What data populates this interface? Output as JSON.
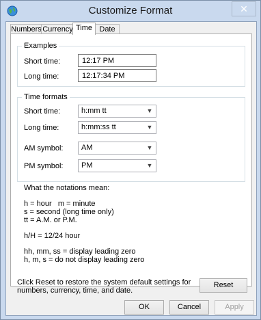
{
  "window": {
    "title": "Customize Format",
    "close_glyph": "✕",
    "icon": "globe-icon"
  },
  "tabs": [
    {
      "label": "Numbers",
      "active": false
    },
    {
      "label": "Currency",
      "active": false
    },
    {
      "label": "Time",
      "active": true
    },
    {
      "label": "Date",
      "active": false
    }
  ],
  "examples": {
    "legend": "Examples",
    "short_label": "Short time:",
    "short_value": "12:17 PM",
    "long_label": "Long time:",
    "long_value": "12:17:34 PM"
  },
  "time_formats": {
    "legend": "Time formats",
    "short_label": "Short time:",
    "short_value": "h:mm tt",
    "long_label": "Long time:",
    "long_value": "h:mm:ss tt",
    "am_label": "AM symbol:",
    "am_value": "AM",
    "pm_label": "PM symbol:",
    "pm_value": "PM"
  },
  "notations": {
    "heading": "What the notations mean:",
    "line1": "h = hour   m = minute",
    "line2": "s = second (long time only)",
    "line3": "tt = A.M. or P.M.",
    "line4": "h/H = 12/24 hour",
    "line5": "hh, mm, ss = display leading zero",
    "line6": "h, m, s = do not display leading zero"
  },
  "reset": {
    "text_line1": "Click Reset to restore the system default settings for",
    "text_line2": "numbers, currency, time, and date.",
    "button": "Reset"
  },
  "buttons": {
    "ok": "OK",
    "cancel": "Cancel",
    "apply": "Apply"
  },
  "colors": {
    "frame": "#c9d9ee",
    "client": "#f0f0f0",
    "panel": "#ffffff"
  }
}
